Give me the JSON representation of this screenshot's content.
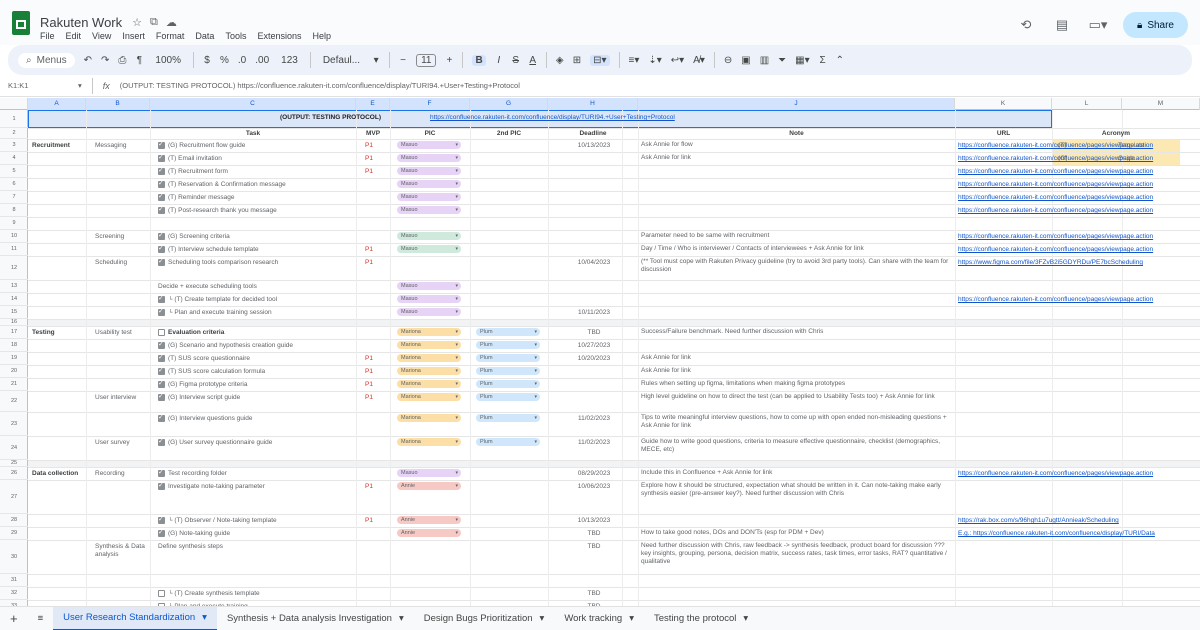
{
  "window": {
    "doc_title": "Rakuten Work",
    "menu": [
      "File",
      "Edit",
      "View",
      "Insert",
      "Format",
      "Data",
      "Tools",
      "Extensions",
      "Help"
    ],
    "share_label": "Share"
  },
  "toolbar": {
    "search_label": "Menus",
    "zoom": "100%",
    "currency": "$",
    "percent": "%",
    "dec_minus": ".0",
    "dec_plus": ".00",
    "number_format": "123",
    "font": "Defaul...",
    "font_size": "11"
  },
  "formula": {
    "name_box": "K1:K1",
    "fx": "fx",
    "content": "(OUTPUT: TESTING PROTOCOL) https://confluence.rakuten-it.com/confluence/display/TURI94.+User+Testing+Protocol"
  },
  "columns": [
    "A",
    "B",
    "C",
    "D",
    "E",
    "F",
    "G",
    "H",
    "I",
    "J",
    "K",
    "L",
    "M"
  ],
  "row_numbers": [
    "1",
    "2",
    "3",
    "4",
    "5",
    "6",
    "7",
    "8",
    "9",
    "10",
    "11",
    "12",
    "13",
    "14",
    "15",
    "16",
    "17",
    "18",
    "19",
    "20",
    "21",
    "22",
    "23",
    "24",
    "25",
    "26",
    "27",
    "28",
    "29",
    "30",
    "31",
    "32",
    "33"
  ],
  "row1": {
    "title": "(OUTPUT: TESTING PROTOCOL)",
    "link": "https://confluence.rakuten-it.com/confluence/display/TURI94.+User+Testing+Protocol"
  },
  "headers": {
    "task": "Task",
    "mvp": "MVP",
    "pic": "PIC",
    "pic2": "2nd PIC",
    "deadline": "Deadline",
    "note": "Note",
    "url": "URL",
    "acronym": "Acronym"
  },
  "sections": {
    "recruitment": "Recruitment",
    "testing": "Testing",
    "data_collection": "Data collection"
  },
  "subsections": {
    "messaging": "Messaging",
    "screening": "Screening",
    "scheduling": "Scheduling",
    "usability_test": "Usability test",
    "user_interview": "User interview",
    "user_survey": "User survey",
    "recording": "Recording",
    "synthesis": "Synthesis & Data analysis"
  },
  "tasks": [
    "(G) Recruitment flow guide",
    "(T) Email invitation",
    "(T) Recruitment form",
    "(T) Reservation & Confirmation message",
    "(T) Reminder message",
    "(T) Post-research thank you message",
    "(G) Screening criteria",
    "(T) Interview schedule template",
    "Scheduling tools comparison research",
    "Decide + execute scheduling tools",
    "└ (T) Create template for decided tool",
    "└ Plan and execute training session",
    "Evaluation criteria",
    "(G) Scenario and hypothesis creation guide",
    "(T) SUS score questionnaire",
    "(T) SUS score calculation formula",
    "(G) Figma prototype criteria",
    "(G) Interview script guide",
    "(G) Interview questions guide",
    "(G) User survey questionnaire guide",
    "Test recording folder",
    "Investigate note-taking parameter",
    "└ (T) Observer / Note-taking template",
    "(G) Note-taking guide",
    "Define synthesis steps",
    "└ (T) Create synthesis template",
    "└ Plan and execute training"
  ],
  "mvp_mark": "P1",
  "people": {
    "masa": "Masuo",
    "maru": "Mariona",
    "plum": "Plum",
    "annie": "Annie"
  },
  "deadlines": [
    "10/13/2023",
    "10/04/2023",
    "10/11/2023",
    "TBD",
    "10/27/2023",
    "10/20/2023",
    "11/02/2023",
    "11/02/2023",
    "08/29/2023",
    "10/06/2023",
    "10/13/2023",
    "TBD",
    "TBD",
    "TBD",
    "TBD"
  ],
  "notes": [
    "Ask Annie for flow",
    "Ask Annie for link",
    "Parameter need to be same with recruitment",
    "Day / Time / Who is interviewer / Contacts of interviewees + Ask Annie for link",
    "(** Tool must cope with Rakuten Privacy guideline (try to avoid 3rd party tools). Can share with the team for discussion",
    "Success/Failure benchmark. Need further discussion with Chris",
    "Ask Annie for link",
    "Ask Annie for link",
    "Rules when setting up figma, limitations when making figma prototypes",
    "High level guideline on how to direct the test (can be applied to Usability Tests too) + Ask Annie for link",
    "Tips to write meaningful interview questions, how to come up with open ended non-misleading questions + Ask Annie for link",
    "Guide how to write good questions, criteria to measure effective questionnaire, checklist (demographics, MECE, etc)",
    "Include this in Confluence + Ask Annie for link",
    "Explore how it should be structured, expectation what should be written in it. Can note-taking make early synthesis easier (pre-answer key?). Need further discussion with Chris",
    "How to take good notes, DOs and DON'Ts (esp for PDM + Dev)",
    "Need further discussion with Chris, raw feedback -> synthesis feedback, product board for discussion ??? key insights, grouping, persona, decision matrix, success rates, task times, error tasks, RAT? quantitative / qualitative"
  ],
  "urls": {
    "conf_short": "https://confluence.rakuten-it.com/confluence/pages/viewpage.action",
    "figma": "https://www.figma.com/file/3FZvB2i5GDYRDu/PE7bcScheduling",
    "box": "https://rak.box.com/s/96hgh1u7ugtt/Annieak/Scheduling",
    "eg": "E.g.: https://confluence.rakuten-it.com/confluence/display/TURI/Data"
  },
  "acronym": [
    {
      "key": "(T)",
      "value": "Template"
    },
    {
      "key": "(G)",
      "value": "Guide"
    }
  ],
  "chip_colors": {
    "masa": "#e7d3f5",
    "maru": "#fbdfa6",
    "plum": "#cfe6fb",
    "annie": "#f7c9c4",
    "green": "#cfe9dc"
  },
  "sheet_tabs": [
    "User Research Standardization",
    "Synthesis + Data analysis Investigation",
    "Design Bugs Prioritization",
    "Work tracking",
    "Testing the protocol"
  ]
}
